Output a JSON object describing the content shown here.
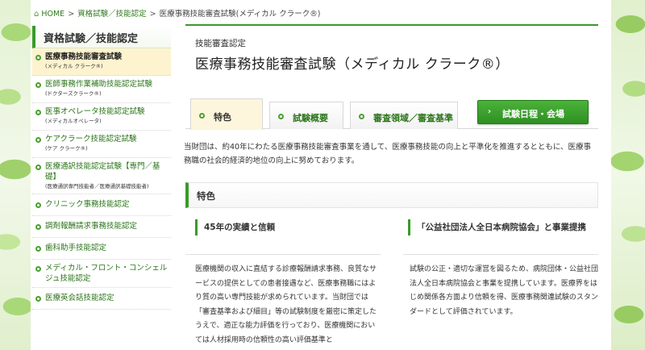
{
  "breadcrumb": {
    "home": "HOME",
    "level1": "資格試験／技能認定",
    "current": "医療事務技能審査試験(メディカル クラーク®)",
    "sep": ">"
  },
  "sidebar": {
    "heading": "資格試験／技能認定",
    "items": [
      {
        "label": "医療事務技能審査試験",
        "sub": "(メディカル クラーク®)"
      },
      {
        "label": "医師事務作業補助技能認定試験",
        "sub": "(ドクターズクラーク®)"
      },
      {
        "label": "医事オペレータ技能認定試験",
        "sub": "(メディカルオペレータ)"
      },
      {
        "label": "ケアクラーク技能認定試験",
        "sub": "(ケア クラーク®)"
      },
      {
        "label": "医療通訳技能認定試験【専門／基礎】",
        "sub": "(医療通訳専門技能者／医療通訳基礎技能者)"
      },
      {
        "label": "クリニック事務技能認定"
      },
      {
        "label": "調剤報酬請求事務技能認定"
      },
      {
        "label": "歯科助手技能認定"
      },
      {
        "label": "メディカル・フロント・コンシェルジュ技能認定"
      },
      {
        "label": "医療英会話技能認定"
      }
    ]
  },
  "header": {
    "category": "技能審査認定",
    "title": "医療事務技能審査試験（メディカル クラーク®）"
  },
  "tabs": [
    {
      "label": "特色"
    },
    {
      "label": "試験概要"
    },
    {
      "label": "審査領域／審査基準"
    }
  ],
  "schedule_button": {
    "label": "試験日程・会場",
    "arrow": "›"
  },
  "intro": "当財団は、約40年にわたる医療事務技能審査事業を通して、医療事務技能の向上と平準化を推進するとともに、医療事務職の社会的経済的地位の向上に努めております。",
  "section": {
    "heading": "特色"
  },
  "columns": [
    {
      "title": "45年の実績と信頼",
      "text": "医療機関の収入に直結する診療報酬請求事務、良質なサービスの提供としての患者接遇など、医療事務職にはより質の高い専門技能が求められています。当財団では「審査基準および細目」等の試験制度を厳密に策定したうえで、適正な能力評価を行っており、医療機関においては人材採用時の信頼性の高い評価基準と"
    },
    {
      "title": "「公益社団法人全日本病院協会」と事業提携",
      "text": "試験の公正・適切な運営を図るため、病院団体・公益社団法人全日本病院協会と事業を提携しています。医療界をはじめ関係各方面より信頼を得、医療事務関連試験のスタンダードとして評価されています。"
    }
  ],
  "colors": {
    "accent": "#3a9a2a",
    "link": "#2a7418",
    "active_bg": "#fdf3cf"
  }
}
